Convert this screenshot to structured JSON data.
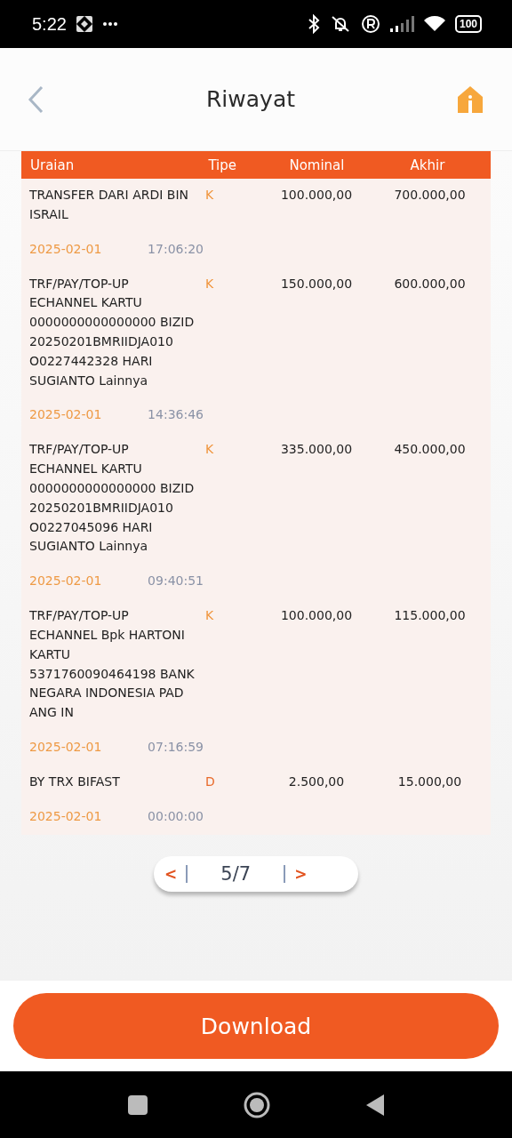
{
  "status_bar": {
    "time": "5:22",
    "battery": "100"
  },
  "app_bar": {
    "title": "Riwayat"
  },
  "table": {
    "columns": [
      "Uraian",
      "Tipe",
      "Nominal",
      "Akhir"
    ],
    "rows": [
      {
        "description": "TRANSFER DARI ARDI BIN ISRAIL",
        "type": "K",
        "nominal": "100.000,00",
        "balance": "700.000,00",
        "date": "2025-02-01",
        "time": "17:06:20"
      },
      {
        "description": "TRF/PAY/TOP-UP ECHANNEL KARTU 0000000000000000 BIZID 20250201BMRIIDJA010 O0227442328 HARI SUGIANTO Lainnya",
        "type": "K",
        "nominal": "150.000,00",
        "balance": "600.000,00",
        "date": "2025-02-01",
        "time": "14:36:46"
      },
      {
        "description": "TRF/PAY/TOP-UP ECHANNEL KARTU 0000000000000000 BIZID 20250201BMRIIDJA010 O0227045096 HARI SUGIANTO Lainnya",
        "type": "K",
        "nominal": "335.000,00",
        "balance": "450.000,00",
        "date": "2025-02-01",
        "time": "09:40:51"
      },
      {
        "description": "TRF/PAY/TOP-UP ECHANNEL Bpk HARTONI KARTU 5371760090464198 BANK NEGARA INDONESIA PAD ANG IN",
        "type": "K",
        "nominal": "100.000,00",
        "balance": "115.000,00",
        "date": "2025-02-01",
        "time": "07:16:59"
      },
      {
        "description": "BY TRX BIFAST",
        "type": "D",
        "nominal": "2.500,00",
        "balance": "15.000,00",
        "date": "2025-02-01",
        "time": "00:00:00"
      }
    ]
  },
  "pagination": {
    "previous": "<",
    "page": "5/7",
    "next": ">"
  },
  "download_button": "Download"
}
